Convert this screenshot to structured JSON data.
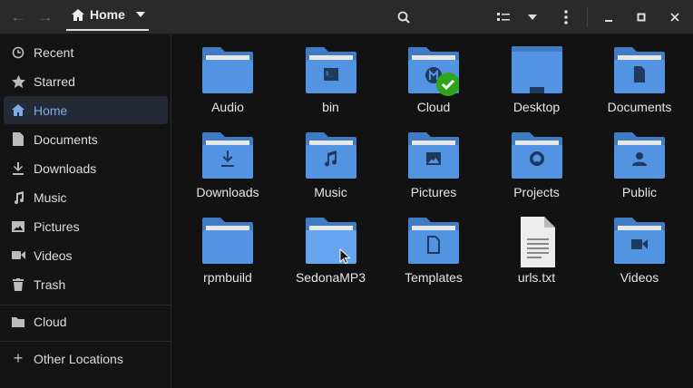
{
  "header": {
    "path_label": "Home",
    "back": "back",
    "forward": "forward"
  },
  "sidebar": {
    "items": [
      {
        "label": "Recent",
        "icon": "clock-icon"
      },
      {
        "label": "Starred",
        "icon": "star-icon"
      },
      {
        "label": "Home",
        "icon": "home-icon",
        "selected": true
      },
      {
        "label": "Documents",
        "icon": "document-icon"
      },
      {
        "label": "Downloads",
        "icon": "download-icon"
      },
      {
        "label": "Music",
        "icon": "music-icon"
      },
      {
        "label": "Pictures",
        "icon": "picture-icon"
      },
      {
        "label": "Videos",
        "icon": "video-icon"
      },
      {
        "label": "Trash",
        "icon": "trash-icon"
      }
    ],
    "cloud": "Cloud",
    "other": "Other Locations"
  },
  "files": [
    {
      "name": "Audio",
      "glyph": "none"
    },
    {
      "name": "bin",
      "glyph": "terminal"
    },
    {
      "name": "Cloud",
      "glyph": "cloud"
    },
    {
      "name": "Desktop",
      "glyph": "desktop"
    },
    {
      "name": "Documents",
      "glyph": "doc"
    },
    {
      "name": "Downloads",
      "glyph": "download"
    },
    {
      "name": "Music",
      "glyph": "music"
    },
    {
      "name": "Pictures",
      "glyph": "picture"
    },
    {
      "name": "Projects",
      "glyph": "github"
    },
    {
      "name": "Public",
      "glyph": "user"
    },
    {
      "name": "rpmbuild",
      "glyph": "none"
    },
    {
      "name": "SedonaMP3",
      "glyph": "hover"
    },
    {
      "name": "Templates",
      "glyph": "template"
    },
    {
      "name": "urls.txt",
      "glyph": "textfile"
    },
    {
      "name": "Videos",
      "glyph": "video"
    }
  ],
  "colors": {
    "folder_back": "#3f7cc4",
    "folder_front": "#5294e2",
    "glyph": "#1e3a5f",
    "selected_text": "#7eaaea"
  }
}
